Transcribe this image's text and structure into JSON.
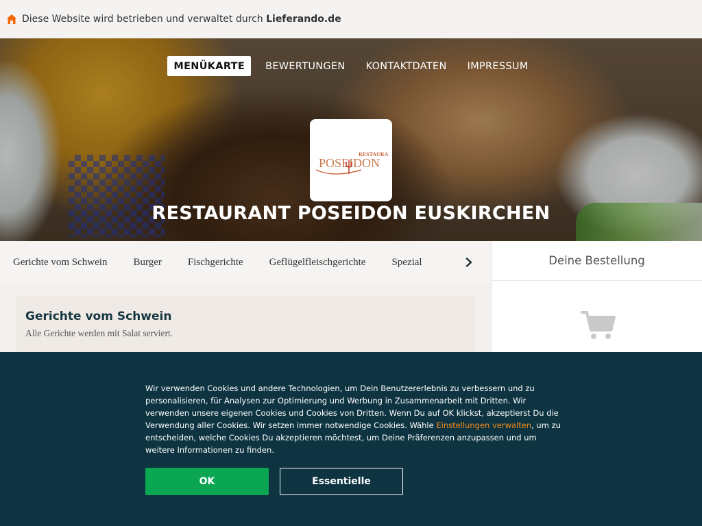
{
  "operator_bar": {
    "prefix": "Diese Website wird betrieben und verwaltet durch ",
    "brand": "Lieferando.de",
    "icon": "house-icon",
    "icon_color": "#f36805"
  },
  "nav": {
    "items": [
      {
        "label": "MENÜKARTE",
        "active": true
      },
      {
        "label": "BEWERTUNGEN",
        "active": false
      },
      {
        "label": "KONTAKTDATEN",
        "active": false
      },
      {
        "label": "IMPRESSUM",
        "active": false
      }
    ]
  },
  "restaurant": {
    "logo_small": "RESTAURANT",
    "logo_name": "POSEIDON",
    "title": "RESTAURANT POSEIDON EUSKIRCHEN"
  },
  "categories": {
    "items": [
      "Gerichte vom Schwein",
      "Burger",
      "Fischgerichte",
      "Geflügelfleischgerichte",
      "Spezial"
    ],
    "next_icon": "chevron-right-icon"
  },
  "section": {
    "title": "Gerichte vom Schwein",
    "subtitle": "Alle Gerichte werden mit Salat serviert."
  },
  "basket": {
    "title": "Deine Bestellung",
    "icon": "shopping-cart-icon"
  },
  "cookie": {
    "text_before_link": "Wir verwenden Cookies und andere Technologien, um Dein Benutzererlebnis zu verbessern und zu personalisieren, für Analysen zur Optimierung und Werbung in Zusammenarbeit mit Dritten. Wir verwenden unsere eigenen Cookies und Cookies von Dritten. Wenn Du auf OK klickst, akzeptierst Du die Verwendung aller Cookies. Wir setzen immer notwendige Cookies. Wähle ",
    "link": "Einstellungen verwalten",
    "text_after_link": ", um zu entscheiden, welche Cookies Du akzeptieren möchtest, um Deine Präferenzen anzupassen und um weitere Informationen zu finden.",
    "ok_label": "OK",
    "essential_label": "Essentielle",
    "colors": {
      "background": "#0e3442",
      "ok": "#0aa652",
      "link": "#f38b1b"
    }
  }
}
